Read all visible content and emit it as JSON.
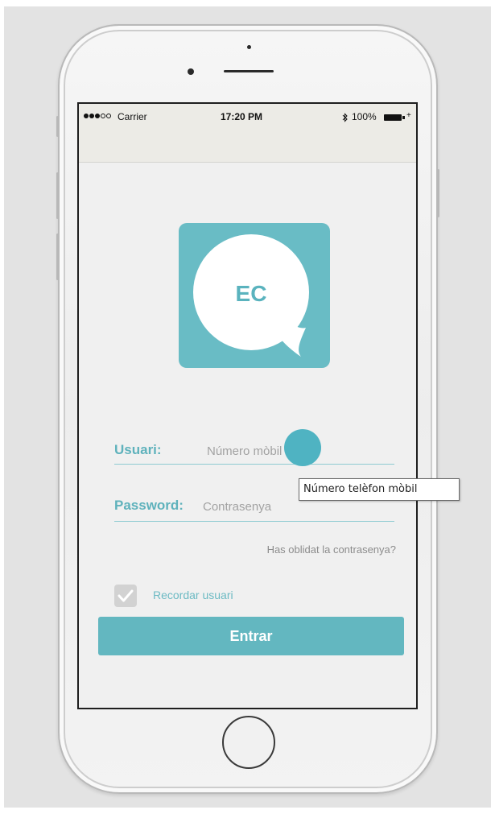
{
  "status_bar": {
    "carrier": "Carrier",
    "time": "17:20 PM",
    "bluetooth_icon": "bluetooth-icon",
    "battery": "100%"
  },
  "logo": {
    "text": "EC",
    "background_color": "#69bcc5",
    "text_color": "#5ab3be"
  },
  "form": {
    "username_label": "Usuari:",
    "username_placeholder": "Número mòbil",
    "password_label": "Password:",
    "password_placeholder": "Contrasenya",
    "forgot_password": "Has oblidat la contrasenya?",
    "remember_label": "Recordar usuari",
    "remember_checked": true,
    "submit_label": "Entrar"
  },
  "tooltip": {
    "text": "Número telèfon mòbil"
  },
  "colors": {
    "accent": "#63b7c0",
    "label": "#5fb2bc",
    "cursor_indicator": "#4fb3c2"
  }
}
